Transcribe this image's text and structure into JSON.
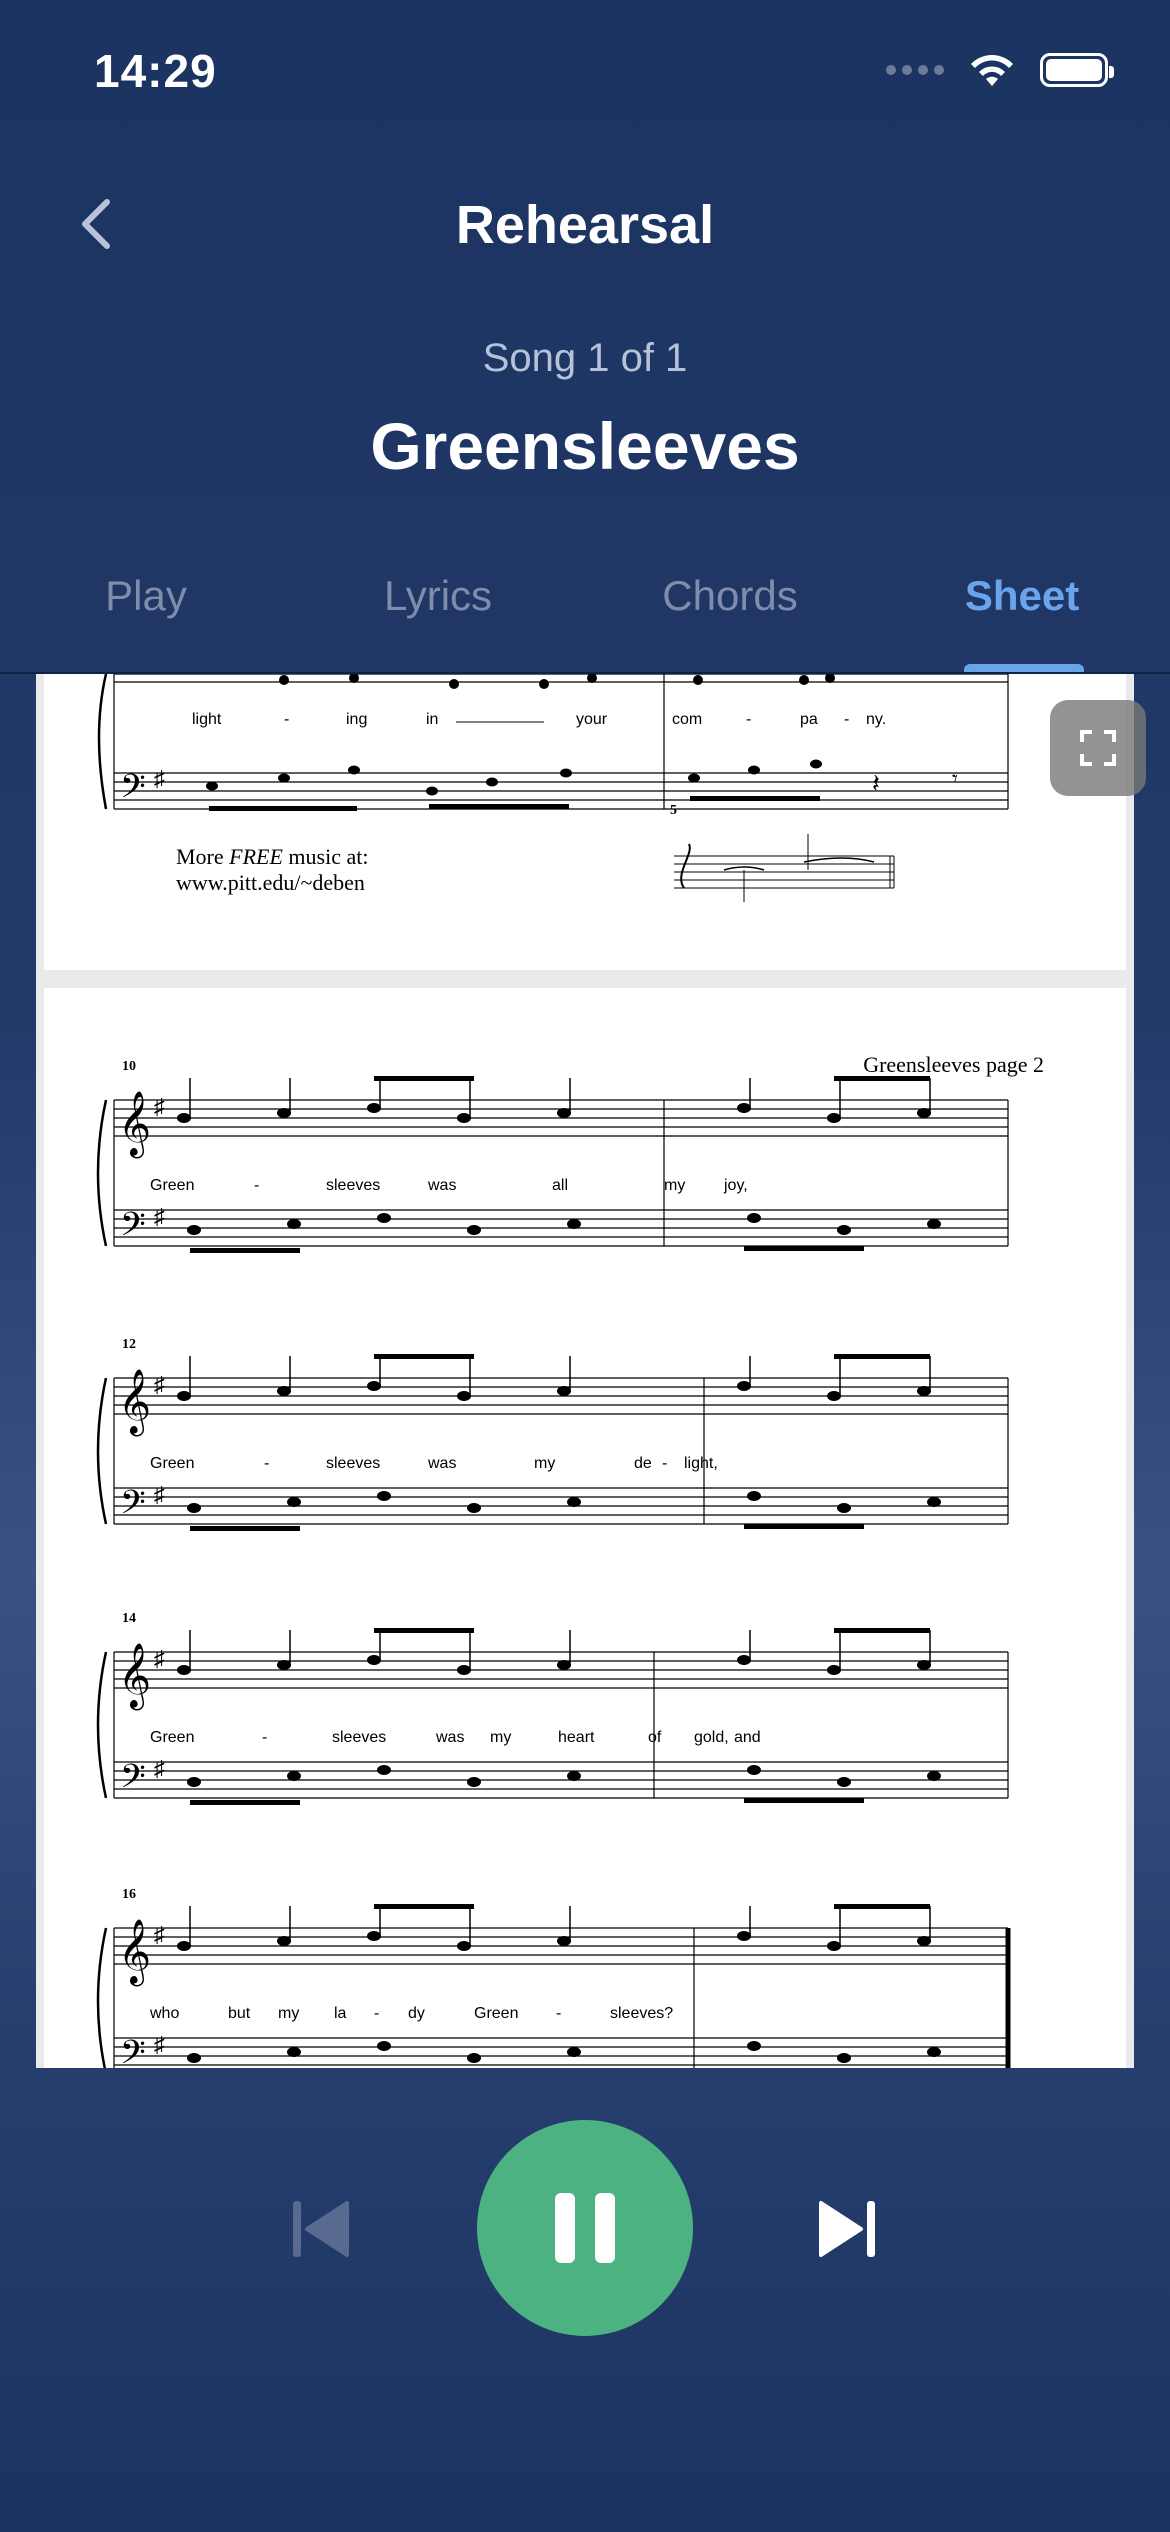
{
  "status": {
    "time": "14:29"
  },
  "header": {
    "title": "Rehearsal"
  },
  "song": {
    "counter": "Song 1 of 1",
    "title": "Greensleeves"
  },
  "tabs": [
    {
      "label": "Play",
      "active": false
    },
    {
      "label": "Lyrics",
      "active": false
    },
    {
      "label": "Chords",
      "active": false
    },
    {
      "label": "Sheet",
      "active": true
    }
  ],
  "sheet": {
    "page1_bottom": {
      "lyrics": [
        "light",
        "-",
        "ing",
        "in",
        "your",
        "com",
        "-",
        "pa",
        "-",
        "ny."
      ],
      "credit_line1_a": "More ",
      "credit_line1_b": "FREE",
      "credit_line1_c": " music at:",
      "credit_line2": "www.pitt.edu/~deben"
    },
    "page2": {
      "header": "Greensleeves page 2",
      "systems": [
        {
          "measure": "10",
          "lyrics": [
            "Green",
            "-",
            "sleeves",
            "was",
            "all",
            "my",
            "joy,"
          ]
        },
        {
          "measure": "12",
          "lyrics": [
            "Green",
            "-",
            "sleeves",
            "was",
            "my",
            "de",
            "-",
            "light,"
          ]
        },
        {
          "measure": "14",
          "lyrics": [
            "Green",
            "-",
            "sleeves",
            "was",
            "my",
            "heart",
            "of",
            "gold,",
            "and"
          ]
        },
        {
          "measure": "16",
          "lyrics": [
            "who",
            "but",
            "my",
            "la",
            "-",
            "dy",
            "Green",
            "-",
            "sleeves?"
          ]
        }
      ]
    }
  },
  "icons": {
    "back": "chevron-left-icon",
    "expand": "expand-icon",
    "prev": "skip-previous-icon",
    "pause": "pause-icon",
    "next": "skip-next-icon"
  },
  "colors": {
    "accent": "#6aa4ec",
    "play": "#4db281",
    "background": "#1c3461"
  }
}
